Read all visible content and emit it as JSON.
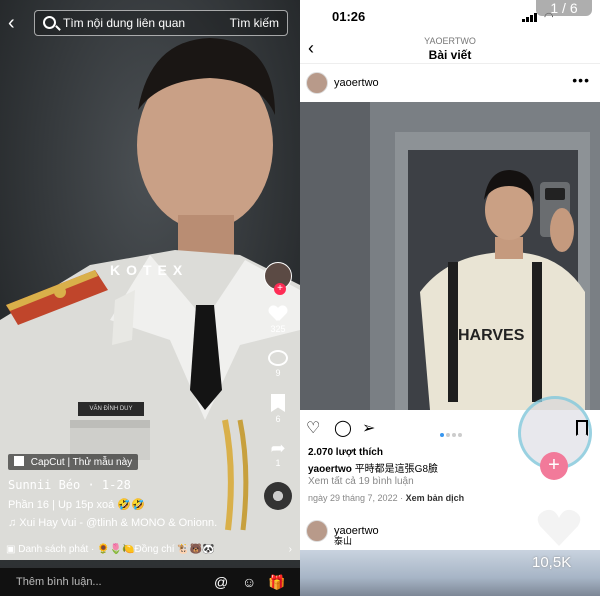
{
  "left": {
    "search": {
      "placeholder": "Tìm nội dung liên quan",
      "button": "Tìm kiếm"
    },
    "watermark": "KOTEX",
    "nametag": "VĂN ĐÌNH DUY",
    "sidebar": {
      "likes": "325",
      "comments": "9",
      "saves": "6",
      "shares": "1"
    },
    "capcut_label": "CapCut | Thử mẫu này",
    "username": "Sunnii Béo · 1-28",
    "description": "Phần 16 | Up 15p xoá 🤣🤣",
    "music": "♫ Xui Hay Vui - @tlinh & MONO & Onionn.",
    "playlist": "Danh sách phát · 🌻🌷🍋Đồng chí 🐮🐻🐼",
    "comment_placeholder": "Thêm bình luận..."
  },
  "right": {
    "status_time": "01:26",
    "pager": "1 / 6",
    "header_user": "YAOERTWO",
    "header_title": "Bài viết",
    "post_user": "yaoertwo",
    "shirt_text": "HARVES",
    "likes": "2.070 lượt thích",
    "caption_user": "yaoertwo",
    "caption_text": "平時都是這張G8臉",
    "view_comments": "Xem tất cả 19 bình luận",
    "date": "ngày 29 tháng 7, 2022",
    "translate": "Xem bản dịch",
    "post2_user": "yaoertwo",
    "post2_sub": "泰山",
    "overlay_count": "10,5K"
  },
  "icons": {
    "back": "chevron-left-icon",
    "search": "search-icon",
    "like": "heart-icon",
    "comment": "comment-icon",
    "bookmark": "bookmark-icon",
    "share": "share-icon",
    "more": "more-icon",
    "send": "send-icon",
    "emoji": "emoji-icon",
    "mention": "mention-icon",
    "gift": "gift-icon"
  },
  "colors": {
    "tiktok_accent": "#fe2c55",
    "ig_link": "#3897f0",
    "plus_pink": "#f27a9a"
  }
}
